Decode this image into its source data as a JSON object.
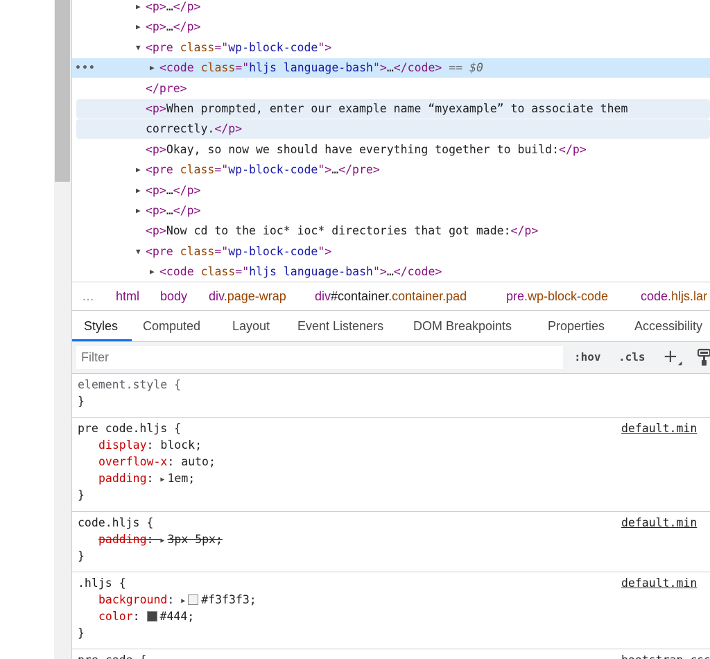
{
  "dom_tree": {
    "lines": [
      {
        "indent": 1,
        "arrow": "collapsed",
        "parts": [
          {
            "c": "tag",
            "t": "<p>"
          },
          {
            "c": "txt",
            "t": "…"
          },
          {
            "c": "tag",
            "t": "</p>"
          }
        ]
      },
      {
        "indent": 1,
        "arrow": "collapsed",
        "parts": [
          {
            "c": "tag",
            "t": "<p>"
          },
          {
            "c": "txt",
            "t": "…"
          },
          {
            "c": "tag",
            "t": "</p>"
          }
        ]
      },
      {
        "indent": 1,
        "arrow": "expanded",
        "parts": [
          {
            "c": "tag",
            "t": "<pre "
          },
          {
            "c": "attr-name",
            "t": "class"
          },
          {
            "c": "tag",
            "t": "=\""
          },
          {
            "c": "attr-val",
            "t": "wp-block-code"
          },
          {
            "c": "tag",
            "t": "\">"
          }
        ]
      },
      {
        "indent": 2,
        "arrow": "collapsed",
        "selected": true,
        "parts": [
          {
            "c": "tag",
            "t": "<code "
          },
          {
            "c": "attr-name",
            "t": "class"
          },
          {
            "c": "tag",
            "t": "=\""
          },
          {
            "c": "attr-val",
            "t": "hljs language-bash"
          },
          {
            "c": "tag",
            "t": "\">"
          },
          {
            "c": "txt",
            "t": "…"
          },
          {
            "c": "tag",
            "t": "</code>"
          },
          {
            "c": "eq",
            "t": " == $0"
          }
        ]
      },
      {
        "indent": 1,
        "arrow": "none",
        "parts": [
          {
            "c": "tag",
            "t": "</pre>"
          }
        ]
      },
      {
        "indent": 1,
        "arrow": "none",
        "hovered": true,
        "parts": [
          {
            "c": "tag",
            "t": "<p>"
          },
          {
            "c": "txt",
            "t": "When prompted, enter our example name “myexample” to associate them"
          }
        ]
      },
      {
        "indent": 1,
        "arrow": "none",
        "hovered": true,
        "continuation": true,
        "parts": [
          {
            "c": "txt",
            "t": "correctly."
          },
          {
            "c": "tag",
            "t": "</p>"
          }
        ]
      },
      {
        "indent": 1,
        "arrow": "none",
        "parts": [
          {
            "c": "tag",
            "t": "<p>"
          },
          {
            "c": "txt",
            "t": "Okay, so now we should have everything together to build:"
          },
          {
            "c": "tag",
            "t": "</p>"
          }
        ]
      },
      {
        "indent": 1,
        "arrow": "collapsed",
        "parts": [
          {
            "c": "tag",
            "t": "<pre "
          },
          {
            "c": "attr-name",
            "t": "class"
          },
          {
            "c": "tag",
            "t": "=\""
          },
          {
            "c": "attr-val",
            "t": "wp-block-code"
          },
          {
            "c": "tag",
            "t": "\">"
          },
          {
            "c": "txt",
            "t": "…"
          },
          {
            "c": "tag",
            "t": "</pre>"
          }
        ]
      },
      {
        "indent": 1,
        "arrow": "collapsed",
        "parts": [
          {
            "c": "tag",
            "t": "<p>"
          },
          {
            "c": "txt",
            "t": "…"
          },
          {
            "c": "tag",
            "t": "</p>"
          }
        ]
      },
      {
        "indent": 1,
        "arrow": "collapsed",
        "parts": [
          {
            "c": "tag",
            "t": "<p>"
          },
          {
            "c": "txt",
            "t": "…"
          },
          {
            "c": "tag",
            "t": "</p>"
          }
        ]
      },
      {
        "indent": 1,
        "arrow": "none",
        "parts": [
          {
            "c": "tag",
            "t": "<p>"
          },
          {
            "c": "txt",
            "t": "Now cd to the ioc* ioc* directories that got made:"
          },
          {
            "c": "tag",
            "t": "</p>"
          }
        ]
      },
      {
        "indent": 1,
        "arrow": "expanded",
        "parts": [
          {
            "c": "tag",
            "t": "<pre "
          },
          {
            "c": "attr-name",
            "t": "class"
          },
          {
            "c": "tag",
            "t": "=\""
          },
          {
            "c": "attr-val",
            "t": "wp-block-code"
          },
          {
            "c": "tag",
            "t": "\">"
          }
        ]
      },
      {
        "indent": 2,
        "arrow": "collapsed",
        "parts": [
          {
            "c": "tag",
            "t": "<code "
          },
          {
            "c": "attr-name",
            "t": "class"
          },
          {
            "c": "tag",
            "t": "=\""
          },
          {
            "c": "attr-val",
            "t": "hljs language-bash"
          },
          {
            "c": "tag",
            "t": "\">"
          },
          {
            "c": "txt",
            "t": "…"
          },
          {
            "c": "tag",
            "t": "</code>"
          }
        ]
      }
    ],
    "selected_marker": "•••"
  },
  "breadcrumb": {
    "more": "…",
    "items": [
      {
        "tag": "html",
        "suffix": "",
        "suffix_kind": ""
      },
      {
        "tag": "body",
        "suffix": "",
        "suffix_kind": ""
      },
      {
        "tag": "div",
        "suffix": ".page-wrap",
        "suffix_kind": "cls"
      },
      {
        "tag": "div",
        "suffix": "#container",
        "suffix_kind": "plain",
        "suffix2": ".container.pad"
      },
      {
        "tag": "pre",
        "suffix": ".wp-block-code",
        "suffix_kind": "cls"
      },
      {
        "tag": "code",
        "suffix": ".hljs.lar",
        "suffix_kind": "cls"
      }
    ]
  },
  "tabs": [
    {
      "label": "Styles",
      "active": true
    },
    {
      "label": "Computed",
      "active": false
    },
    {
      "label": "Layout",
      "active": false
    },
    {
      "label": "Event Listeners",
      "active": false
    },
    {
      "label": "DOM Breakpoints",
      "active": false
    },
    {
      "label": "Properties",
      "active": false
    },
    {
      "label": "Accessibility",
      "active": false
    }
  ],
  "filter": {
    "placeholder": "Filter",
    "hov": ":hov",
    "cls": ".cls"
  },
  "rules": [
    {
      "selector": "element.style {",
      "muted": true,
      "source": "",
      "props": [],
      "close": "}"
    },
    {
      "selector": "pre code.hljs {",
      "muted": false,
      "source": "default.min",
      "props": [
        {
          "name": "display",
          "value": "block;",
          "struck": false,
          "arrow": false,
          "swatch": ""
        },
        {
          "name": "overflow-x",
          "value": "auto;",
          "struck": false,
          "arrow": false,
          "swatch": ""
        },
        {
          "name": "padding",
          "value": "1em;",
          "struck": false,
          "arrow": true,
          "swatch": ""
        }
      ],
      "close": "}"
    },
    {
      "selector": "code.hljs {",
      "muted": false,
      "source": "default.min",
      "props": [
        {
          "name": "padding",
          "value": "3px 5px;",
          "struck": true,
          "arrow": true,
          "swatch": ""
        }
      ],
      "close": "}"
    },
    {
      "selector": ".hljs {",
      "muted": false,
      "source": "default.min",
      "props": [
        {
          "name": "background",
          "value": "#f3f3f3;",
          "struck": false,
          "arrow": true,
          "swatch": "#f3f3f3"
        },
        {
          "name": "color",
          "value": "#444;",
          "struck": false,
          "arrow": false,
          "swatch": "#444444"
        }
      ],
      "close": "}"
    },
    {
      "selector": "pre code {",
      "muted": false,
      "source": "bootstrap.css:[cr",
      "props": [],
      "close": ""
    }
  ]
}
